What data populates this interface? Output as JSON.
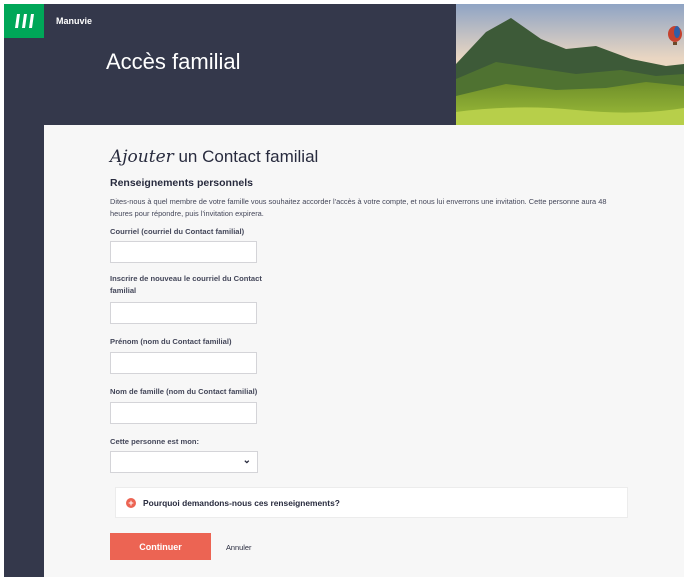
{
  "header": {
    "brand": "Manuvie",
    "page_title": "Accès familial"
  },
  "form": {
    "title_emphasis": "Ajouter",
    "title_rest": " un Contact familial",
    "section_heading": "Renseignements personnels",
    "description": "Dites-nous à quel membre de votre famille vous souhaitez accorder l'accès à votre compte, et nous lui enverrons une invitation. Cette personne aura 48 heures pour répondre, puis l'invitation expirera.",
    "fields": [
      {
        "label": "Courriel (courriel du Contact familial)",
        "value": ""
      },
      {
        "label": "Inscrire de nouveau le courriel du Contact familial",
        "value": ""
      },
      {
        "label": "Prénom (nom du Contact familial)",
        "value": ""
      },
      {
        "label": "Nom de famille (nom du Contact familial)",
        "value": ""
      }
    ],
    "relationship": {
      "label": "Cette personne est mon:",
      "value": ""
    },
    "why_text": "Pourquoi demandons-nous ces renseignements?",
    "continue_label": "Continuer",
    "cancel_label": "Annuler"
  },
  "colors": {
    "navy": "#34384b",
    "brand_green": "#00a758",
    "accent_coral": "#ec6453"
  },
  "icons": {
    "logo": "manulife-logo-icon",
    "select_chevron": "chevron-down-icon",
    "why_badge": "plus-circle-icon"
  }
}
